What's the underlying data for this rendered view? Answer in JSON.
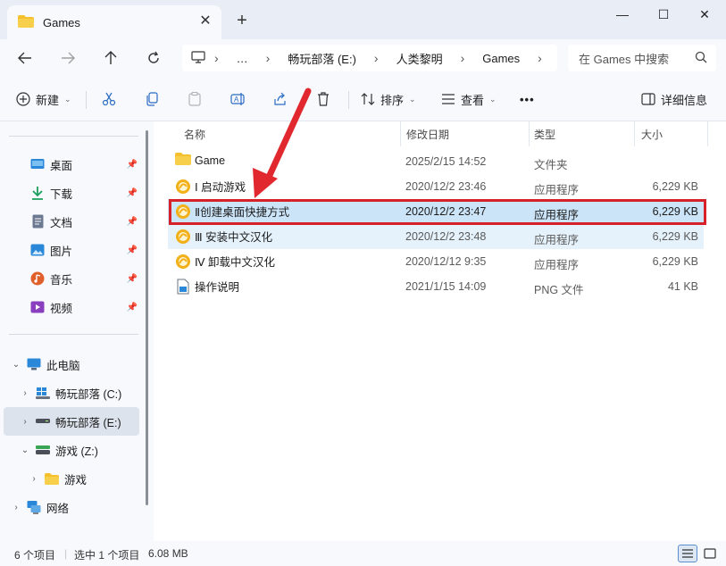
{
  "window": {
    "tab_title": "Games",
    "new_tab_glyph": "+",
    "close_tab_glyph": "✕",
    "minimize_glyph": "—",
    "maximize_glyph": "☐",
    "close_glyph": "✕"
  },
  "nav": {
    "breadcrumb": [
      "…",
      "畅玩部落 (E:)",
      "人类黎明",
      "Games"
    ],
    "search_placeholder": "在 Games 中搜索"
  },
  "toolbar": {
    "new_label": "新建",
    "sort_label": "排序",
    "view_label": "查看",
    "more_glyph": "•••",
    "details_label": "详细信息"
  },
  "sidebar": {
    "quick": [
      {
        "label": "桌面",
        "icon": "desktop-icon",
        "color": "#2b88d8"
      },
      {
        "label": "下载",
        "icon": "download-icon",
        "color": "#1b9e5b"
      },
      {
        "label": "文档",
        "icon": "document-icon",
        "color": "#6b7a90"
      },
      {
        "label": "图片",
        "icon": "pictures-icon",
        "color": "#2b88d8"
      },
      {
        "label": "音乐",
        "icon": "music-icon",
        "color": "#e0602c"
      },
      {
        "label": "视频",
        "icon": "video-icon",
        "color": "#8a3fbf"
      }
    ],
    "this_pc": "此电脑",
    "drive_c": "畅玩部落 (C:)",
    "drive_e": "畅玩部落 (E:)",
    "drive_z": "游戏 (Z:)",
    "folder_games": "游戏",
    "network": "网络"
  },
  "columns": {
    "name": "名称",
    "date": "修改日期",
    "type": "类型",
    "size": "大小"
  },
  "files": [
    {
      "name": "Game",
      "date": "2025/2/15 14:52",
      "type": "文件夹",
      "size": "",
      "icon": "folder-icon"
    },
    {
      "name": "Ⅰ 启动游戏",
      "date": "2020/12/2 23:46",
      "type": "应用程序",
      "size": "6,229 KB",
      "icon": "app-icon"
    },
    {
      "name": "Ⅱ创建桌面快捷方式",
      "date": "2020/12/2 23:47",
      "type": "应用程序",
      "size": "6,229 KB",
      "icon": "app-icon"
    },
    {
      "name": "Ⅲ 安装中文汉化",
      "date": "2020/12/2 23:48",
      "type": "应用程序",
      "size": "6,229 KB",
      "icon": "app-icon"
    },
    {
      "name": "Ⅳ 卸载中文汉化",
      "date": "2020/12/12 9:35",
      "type": "应用程序",
      "size": "6,229 KB",
      "icon": "app-icon"
    },
    {
      "name": "操作说明",
      "date": "2021/1/15 14:09",
      "type": "PNG 文件",
      "size": "41 KB",
      "icon": "image-file-icon"
    }
  ],
  "status": {
    "count": "6 个项目",
    "selected": "选中 1 个项目",
    "size": "6.08 MB"
  },
  "colors": {
    "selection": "#cce4f7",
    "highlight_box": "#d6202a",
    "arrow": "#e0282e",
    "folder": "#f4c02e",
    "app_icon": "#f2b019"
  }
}
